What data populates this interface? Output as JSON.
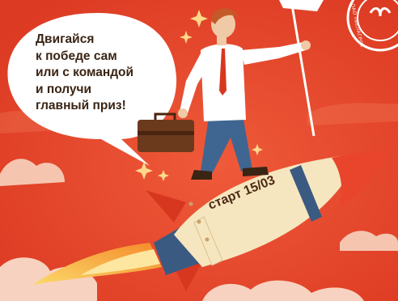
{
  "bubble": {
    "lines": [
      "Двигайся",
      "к победе сам",
      "или с командой",
      "и получи",
      "главный приз!"
    ]
  },
  "rocket": {
    "label": "старт 15/03"
  },
  "seal": {
    "text": "ОАО «БЕЛАГРО»"
  },
  "colors": {
    "background": "#e8452c",
    "rocket_body": "#f6e6bf",
    "flame": "#f7a63a",
    "shirt": "#ffffff",
    "trousers": "#3f6690",
    "skin": "#f0c9a6",
    "hair": "#c45a2a"
  },
  "icons": [
    "speech-bubble",
    "rocket",
    "flag",
    "briefcase",
    "sparkle",
    "cloud",
    "seal-logo"
  ]
}
